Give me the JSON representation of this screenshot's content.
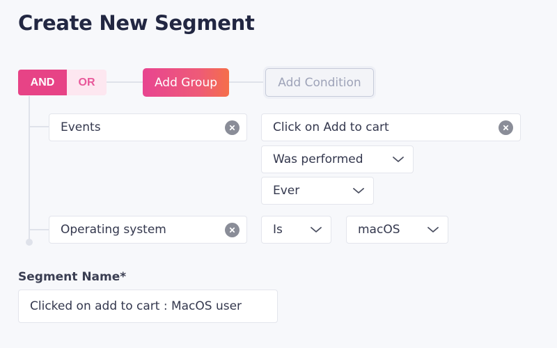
{
  "page": {
    "title": "Create New Segment"
  },
  "logic": {
    "and_label": "AND",
    "or_label": "OR",
    "selected": "AND"
  },
  "actions": {
    "add_group": "Add Group",
    "add_condition": "Add Condition"
  },
  "conditions": [
    {
      "property": "Events",
      "value": "Click on Add to cart",
      "performed": "Was performed",
      "timeframe": "Ever"
    },
    {
      "property": "Operating system",
      "operator": "Is",
      "value": "macOS"
    }
  ],
  "segment_name": {
    "label": "Segment Name*",
    "value": "Clicked on add to cart : MacOS user"
  },
  "colors": {
    "accent": "#e74386",
    "accent_light": "#fde7f0",
    "gradient_end": "#f56f4a",
    "background": "#f7f8fb"
  }
}
